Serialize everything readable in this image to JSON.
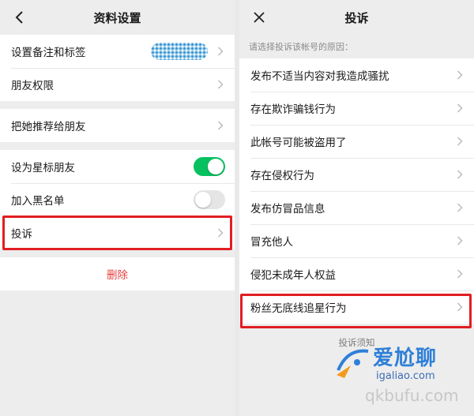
{
  "left": {
    "title": "资料设置",
    "rows_group1": [
      "设置备注和标签",
      "朋友权限"
    ],
    "rows_group2": [
      "把她推荐给朋友"
    ],
    "rows_group3": {
      "star": {
        "label": "设为星标朋友",
        "toggle": "on"
      },
      "blacklist": {
        "label": "加入黑名单",
        "toggle": "off"
      },
      "complain": {
        "label": "投诉"
      }
    },
    "delete_label": "删除"
  },
  "right": {
    "title": "投诉",
    "hint": "请选择投诉该帐号的原因：",
    "reasons": [
      "发布不适当内容对我造成骚扰",
      "存在欺诈骗钱行为",
      "此帐号可能被盗用了",
      "存在侵权行为",
      "发布仿冒品信息",
      "冒充他人",
      "侵犯未成年人权益",
      "粉丝无底线追星行为"
    ],
    "notice": "投诉须知"
  },
  "watermark": {
    "text1": "爱尬聊",
    "text2": "igaliao.com",
    "text3": "qkbufu.com"
  },
  "colors": {
    "switch_on": "#07c160",
    "delete": "#e64340",
    "highlight": "#e11e22"
  }
}
